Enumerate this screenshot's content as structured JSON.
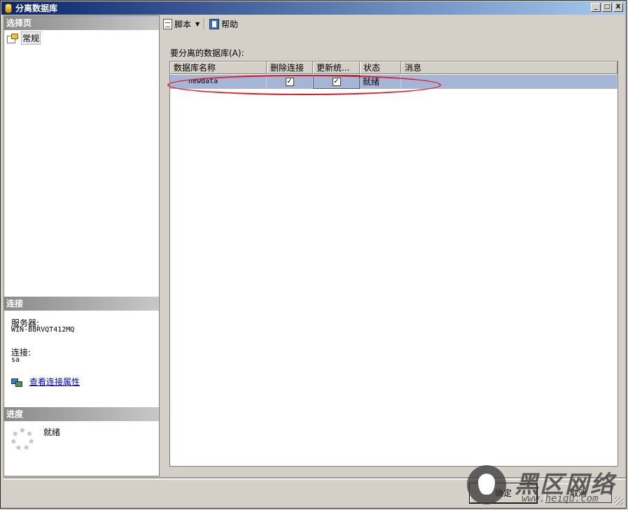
{
  "window": {
    "title": "分离数据库",
    "min": "_",
    "max": "□",
    "close": "X"
  },
  "left": {
    "select_page_header": "选择页",
    "pages": [
      {
        "label": "常规"
      }
    ],
    "connection_header": "连接",
    "server_label": "服务器:",
    "server_value": "WIN-B8RVQT412MQ",
    "connection_label": "连接:",
    "connection_value": "sa",
    "view_props_link": "查看连接属性",
    "progress_header": "进度",
    "progress_status": "就绪"
  },
  "toolbar": {
    "script_label": "脚本",
    "help_label": "帮助"
  },
  "grid": {
    "caption": "要分离的数据库(A):",
    "columns": [
      "数据库名称",
      "删除连接",
      "更新统...",
      "状态",
      "消息"
    ],
    "rows": [
      {
        "name": "newdata",
        "drop_connections": "✓",
        "update_stats": "✓",
        "status": "就绪",
        "message": ""
      }
    ]
  },
  "buttons": {
    "ok": "确定",
    "cancel": "取消"
  },
  "watermark": {
    "text": "黑区网络",
    "url": "www.heiqu.com"
  },
  "colors": {
    "selected_row": "#a6b4d6",
    "annotation_ellipse": "#e0141e",
    "title_gradient_start": "#0a246a"
  }
}
